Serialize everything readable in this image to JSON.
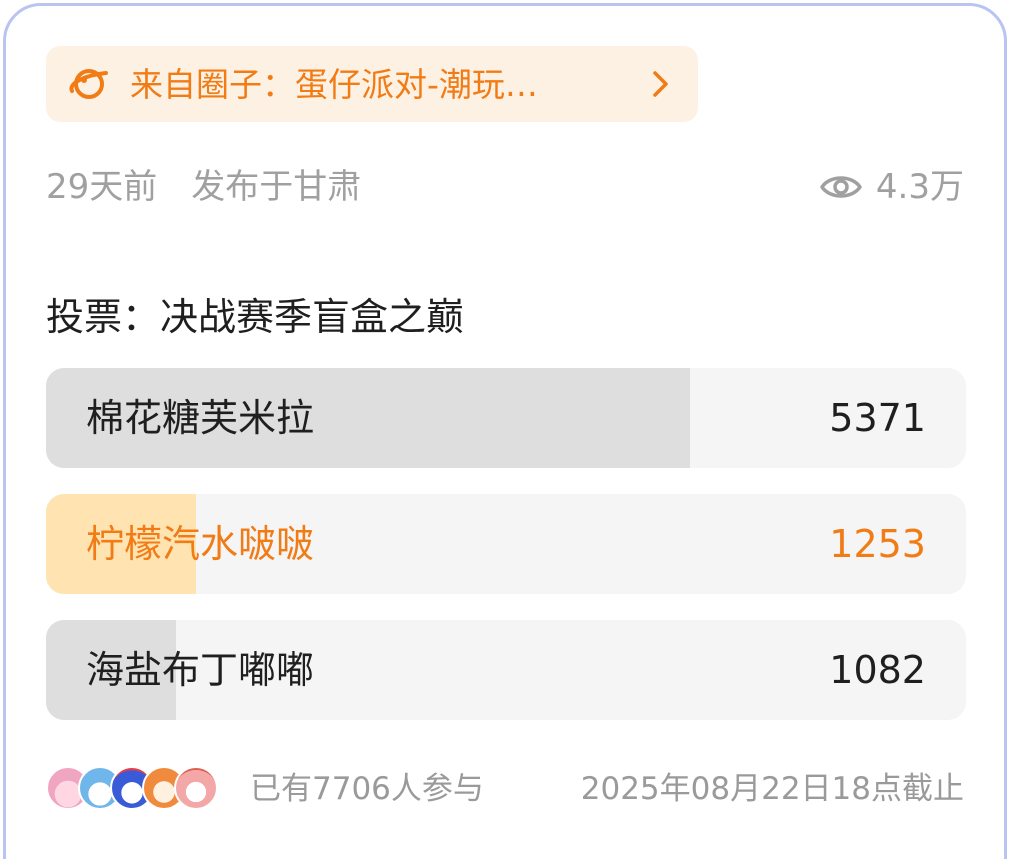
{
  "banner": {
    "text": "来自圈子：蛋仔派对-潮玩…"
  },
  "meta": {
    "time": "29天前",
    "location": "发布于甘肃",
    "views": "4.3万"
  },
  "poll": {
    "title": "投票：决战赛季盲盒之巅",
    "options": [
      {
        "label": "棉花糖芙米拉",
        "count": "5371",
        "fraction": 0.7,
        "fill_color": "#dedede",
        "text_color": "#1f1f1f"
      },
      {
        "label": "柠檬汽水啵啵",
        "count": "1253",
        "fraction": 0.163,
        "fill_color": "#ffe3b0",
        "text_color": "#f17c16"
      },
      {
        "label": "海盐布丁嘟嘟",
        "count": "1082",
        "fraction": 0.141,
        "fill_color": "#dedede",
        "text_color": "#1f1f1f"
      }
    ]
  },
  "footer": {
    "participants": "已有7706人参与",
    "deadline": "2025年08月22日18点截止"
  },
  "colors": {
    "accent": "#f17c16",
    "banner_bg": "#fdf1e3",
    "muted": "#a0a0a0"
  }
}
